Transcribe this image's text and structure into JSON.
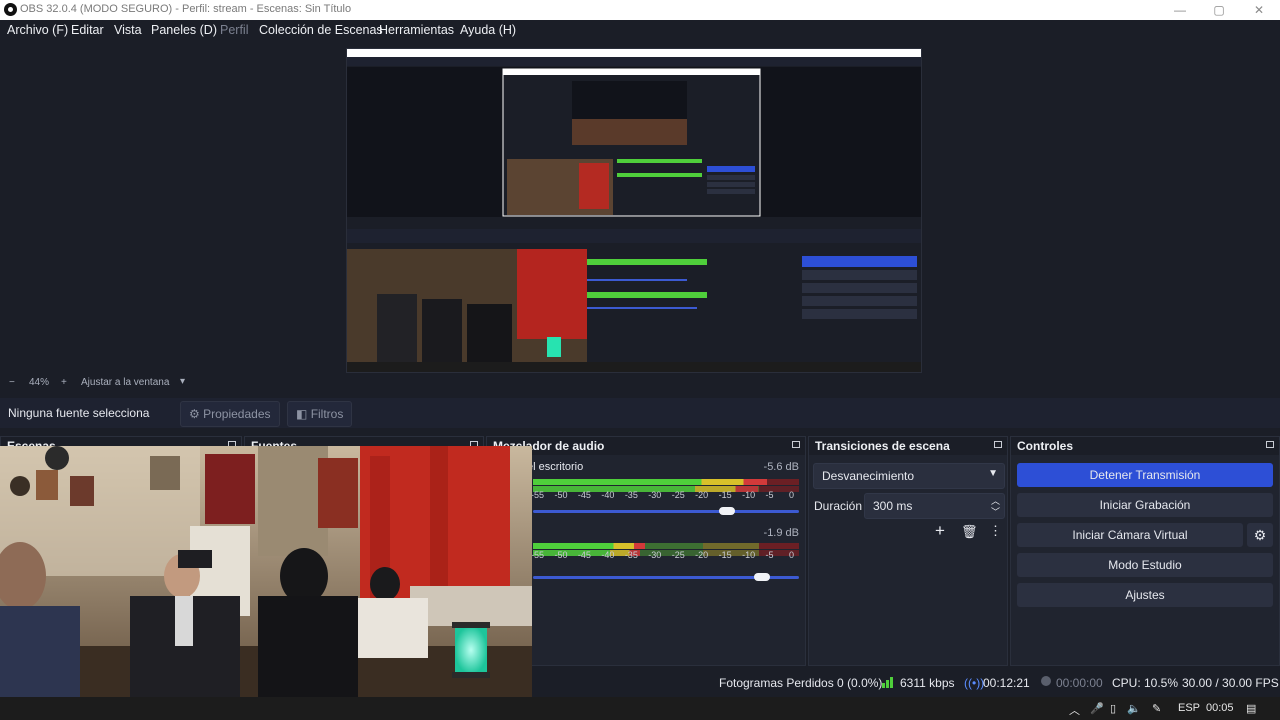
{
  "window": {
    "title": "OBS 32.0.4 (MODO SEGURO) - Perfil: stream - Escenas: Sin Título"
  },
  "menu": [
    "Archivo (F)",
    "Editar",
    "Vista",
    "Paneles (D)",
    "Perfil",
    "Colección de Escenas",
    "Herramientas",
    "Ayuda (H)"
  ],
  "zoom": {
    "minus": "−",
    "value": "44%",
    "plus": "+",
    "fit_label": "Ajustar a la ventana"
  },
  "source_toolbar": {
    "no_selection": "Ninguna fuente selecciona",
    "properties": "Propiedades",
    "filters": "Filtros"
  },
  "docks": {
    "scenes": "Escenas",
    "sources": "Fuentes",
    "audio_mixer": "Mezclador de audio",
    "transitions": "Transiciones de escena",
    "controls": "Controles"
  },
  "audio": {
    "channels": [
      {
        "name": "el escritorio",
        "db": "-5.6 dB",
        "level": 0.88,
        "volume": 0.73
      },
      {
        "name": "",
        "db": "-1.9 dB",
        "level": 0.42,
        "volume": 0.86
      }
    ],
    "ticks": [
      "-55",
      "-50",
      "-45",
      "-40",
      "-35",
      "-30",
      "-25",
      "-20",
      "-15",
      "-10",
      "-5",
      "0"
    ]
  },
  "transitions": {
    "selected": "Desvanecimiento",
    "duration_label": "Duración",
    "duration_value": "300 ms"
  },
  "controls": {
    "stop_stream": "Detener Transmisión",
    "start_recording": "Iniciar Grabación",
    "start_virtual_cam": "Iniciar Cámara Virtual",
    "studio_mode": "Modo Estudio",
    "settings": "Ajustes"
  },
  "status": {
    "dropped_frames": "Fotogramas Perdidos 0 (0.0%)",
    "bitrate": "6311 kbps",
    "stream_time": "00:12:21",
    "record_time": "00:00:00",
    "cpu": "CPU: 10.5%",
    "fps": "30.00 / 30.00 FPS"
  },
  "taskbar": {
    "language": "ESP",
    "clock": "00:05"
  },
  "colors": {
    "accent": "#2d4fd6",
    "meter_green": "#4fcf3b",
    "meter_yellow": "#d8c12a",
    "meter_red": "#d33a3a"
  }
}
